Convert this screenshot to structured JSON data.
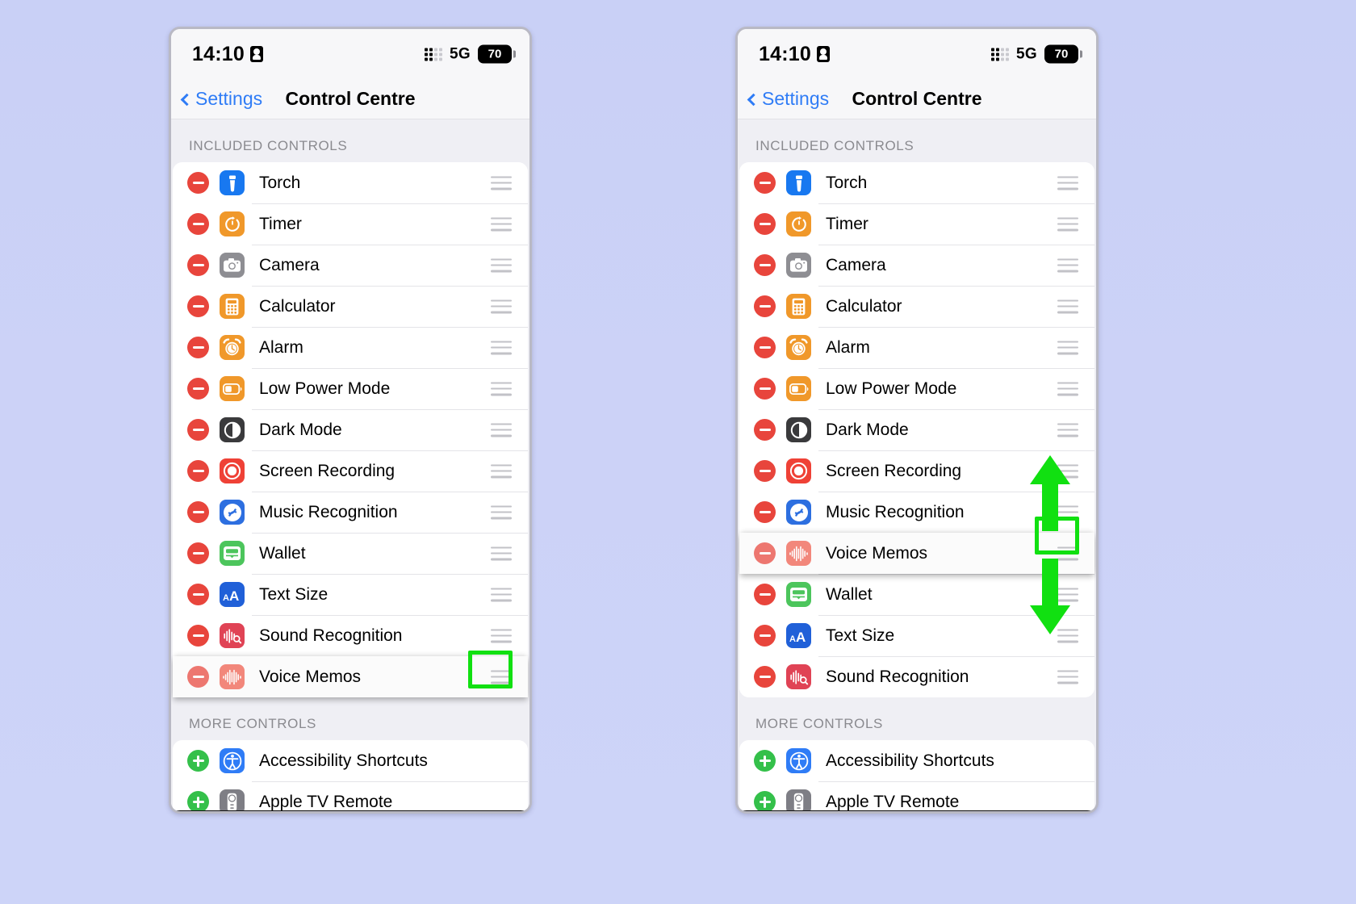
{
  "status_bar": {
    "time": "14:10",
    "lock_icon": "portrait-orientation-lock-icon",
    "network": "5G",
    "battery_level": "70",
    "signal_icon": "cellular-signal-icon"
  },
  "nav": {
    "back_label": "Settings",
    "back_icon": "chevron-left-icon",
    "title": "Control Centre"
  },
  "sections": {
    "included": "INCLUDED CONTROLS",
    "more": "MORE CONTROLS"
  },
  "colors": {
    "accent_blue": "#2f7cf6",
    "remove_red": "#e8453c",
    "add_green": "#34c04a",
    "annotation_green": "#11e011",
    "page_background": "#ccd3f7",
    "list_background": "#efeff4"
  },
  "annotations": {
    "highlight_box_label": "drag-handle-highlight",
    "arrow_up_label": "drag-up-arrow",
    "arrow_down_label": "drag-down-arrow"
  },
  "left_phone": {
    "included_controls": [
      {
        "label": "Torch",
        "icon": "torch-icon",
        "action": "remove"
      },
      {
        "label": "Timer",
        "icon": "timer-icon",
        "action": "remove"
      },
      {
        "label": "Camera",
        "icon": "camera-icon",
        "action": "remove"
      },
      {
        "label": "Calculator",
        "icon": "calculator-icon",
        "action": "remove"
      },
      {
        "label": "Alarm",
        "icon": "alarm-icon",
        "action": "remove"
      },
      {
        "label": "Low Power Mode",
        "icon": "low-power-mode-icon",
        "action": "remove"
      },
      {
        "label": "Dark Mode",
        "icon": "dark-mode-icon",
        "action": "remove"
      },
      {
        "label": "Screen Recording",
        "icon": "screen-recording-icon",
        "action": "remove"
      },
      {
        "label": "Music Recognition",
        "icon": "music-recognition-icon",
        "action": "remove"
      },
      {
        "label": "Wallet",
        "icon": "wallet-icon",
        "action": "remove"
      },
      {
        "label": "Text Size",
        "icon": "text-size-icon",
        "action": "remove"
      },
      {
        "label": "Sound Recognition",
        "icon": "sound-recognition-icon",
        "action": "remove"
      },
      {
        "label": "Voice Memos",
        "icon": "voice-memos-icon",
        "action": "remove",
        "state": "lifted"
      }
    ],
    "more_controls": [
      {
        "label": "Accessibility Shortcuts",
        "icon": "accessibility-icon",
        "action": "add"
      },
      {
        "label": "Apple TV Remote",
        "icon": "apple-tv-remote-icon",
        "action": "add"
      }
    ]
  },
  "right_phone": {
    "included_controls": [
      {
        "label": "Torch",
        "icon": "torch-icon",
        "action": "remove"
      },
      {
        "label": "Timer",
        "icon": "timer-icon",
        "action": "remove"
      },
      {
        "label": "Camera",
        "icon": "camera-icon",
        "action": "remove"
      },
      {
        "label": "Calculator",
        "icon": "calculator-icon",
        "action": "remove"
      },
      {
        "label": "Alarm",
        "icon": "alarm-icon",
        "action": "remove"
      },
      {
        "label": "Low Power Mode",
        "icon": "low-power-mode-icon",
        "action": "remove"
      },
      {
        "label": "Dark Mode",
        "icon": "dark-mode-icon",
        "action": "remove"
      },
      {
        "label": "Screen Recording",
        "icon": "screen-recording-icon",
        "action": "remove"
      },
      {
        "label": "Music Recognition",
        "icon": "music-recognition-icon",
        "action": "remove"
      },
      {
        "label": "Voice Memos",
        "icon": "voice-memos-icon",
        "action": "remove",
        "state": "lifted"
      },
      {
        "label": "Wallet",
        "icon": "wallet-icon",
        "action": "remove"
      },
      {
        "label": "Text Size",
        "icon": "text-size-icon",
        "action": "remove"
      },
      {
        "label": "Sound Recognition",
        "icon": "sound-recognition-icon",
        "action": "remove"
      }
    ],
    "more_controls": [
      {
        "label": "Accessibility Shortcuts",
        "icon": "accessibility-icon",
        "action": "add"
      },
      {
        "label": "Apple TV Remote",
        "icon": "apple-tv-remote-icon",
        "action": "add"
      }
    ]
  }
}
